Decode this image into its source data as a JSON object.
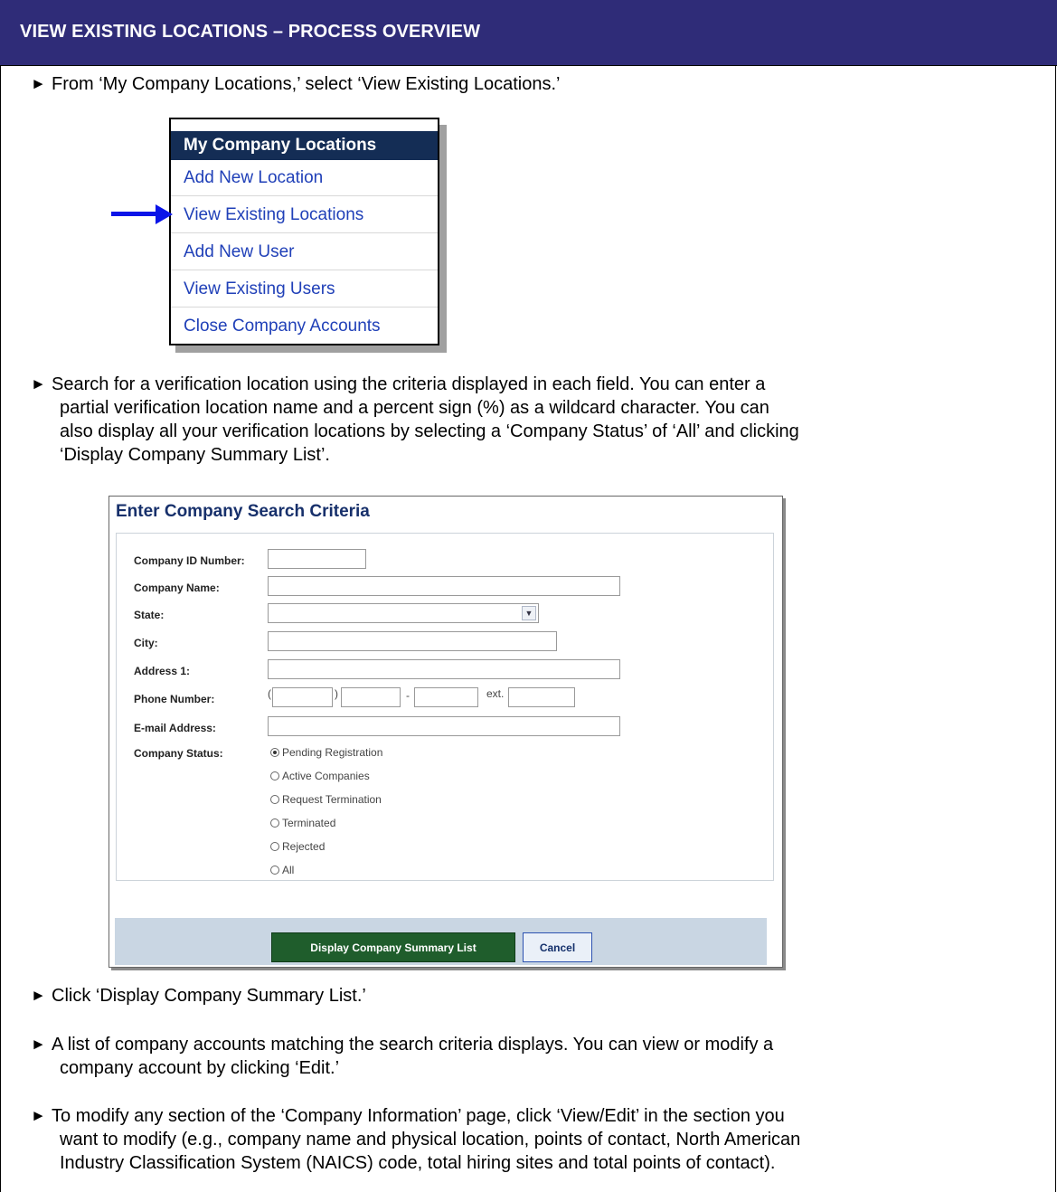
{
  "header": {
    "title": "VIEW EXISTING LOCATIONS – PROCESS OVERVIEW"
  },
  "bullet_glyph": "►",
  "steps": {
    "s1": "From ‘My Company Locations,’ select ‘View Existing Locations.’",
    "s2": [
      "Search for a verification location using the criteria displayed in each field. You can enter a",
      "partial verification location name and a percent sign (%) as a wildcard character. You can",
      "also display all your verification locations by selecting a ‘Company Status’ of ‘All’ and clicking",
      "‘Display Company Summary List’."
    ],
    "s3": "Click ‘Display Company Summary List.’",
    "s4": [
      "A list of company accounts matching the search criteria displays. You can view or modify a",
      "company account by clicking ‘Edit.’"
    ],
    "s5": [
      "To modify any section of the ‘Company Information’ page, click ‘View/Edit’ in the section you",
      "want to modify (e.g., company name and physical location, points of contact, North American",
      "Industry Classification System (NAICS) code, total hiring sites and total points of contact)."
    ]
  },
  "menu": {
    "title": "My Company Locations",
    "items": [
      "Add New Location",
      "View Existing Locations",
      "Add New User",
      "View Existing Users",
      "Close Company Accounts"
    ],
    "highlight_color": "#0a14e8"
  },
  "search": {
    "title": "Enter Company Search Criteria",
    "labels": {
      "company_id": "Company ID Number:",
      "company_name": "Company Name:",
      "state": "State:",
      "city": "City:",
      "address1": "Address 1:",
      "phone": "Phone Number:",
      "email": "E-mail Address:",
      "status": "Company Status:"
    },
    "phone_marks": {
      "open": "(",
      "close": ")",
      "dash": "-",
      "ext": "ext."
    },
    "status_options": [
      "Pending Registration",
      "Active Companies",
      "Request Termination",
      "Terminated",
      "Rejected",
      "All"
    ],
    "status_selected": "Pending Registration",
    "buttons": {
      "display": "Display Company Summary List",
      "cancel": "Cancel"
    }
  }
}
